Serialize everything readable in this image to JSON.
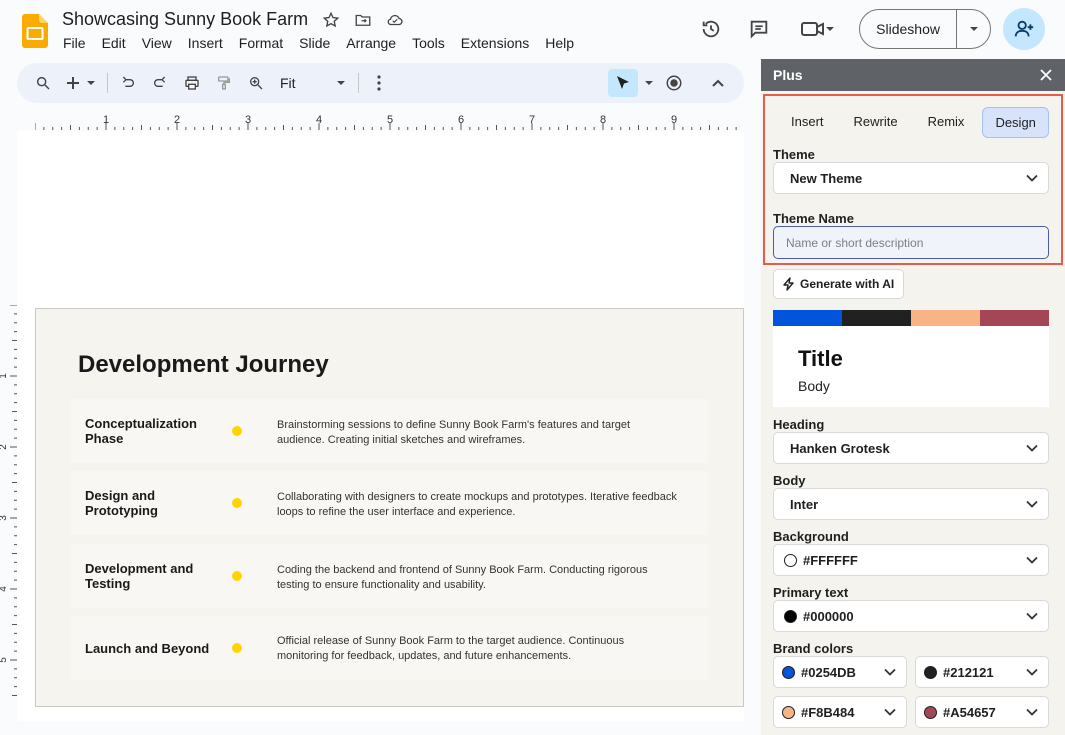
{
  "document": {
    "title": "Showcasing Sunny Book Farm"
  },
  "menu": [
    "File",
    "Edit",
    "View",
    "Insert",
    "Format",
    "Slide",
    "Arrange",
    "Tools",
    "Extensions",
    "Help"
  ],
  "header": {
    "slideshow_label": "Slideshow"
  },
  "toolbar": {
    "zoom_value": "Fit"
  },
  "ruler": {
    "h_numbers": [
      "1",
      "2",
      "3",
      "4",
      "5",
      "6",
      "7",
      "8",
      "9"
    ],
    "v_numbers": [
      "1",
      "2",
      "3",
      "4",
      "5"
    ]
  },
  "slide": {
    "title": "Development Journey",
    "phases": [
      {
        "name": "Conceptualization Phase",
        "description": "Brainstorming sessions to define Sunny Book Farm's features and target audience. Creating initial sketches and wireframes."
      },
      {
        "name": "Design and Prototyping",
        "description": "Collaborating with designers to create mockups and prototypes. Iterative feedback loops to refine the user interface and experience."
      },
      {
        "name": "Development and Testing",
        "description": "Coding the backend and frontend of Sunny Book Farm. Conducting rigorous testing to ensure functionality and usability."
      },
      {
        "name": "Launch and Beyond",
        "description": "Official release of Sunny Book Farm to the target audience. Continuous monitoring for feedback, updates, and future enhancements."
      }
    ],
    "dot_color": "#FFD400"
  },
  "panel": {
    "title": "Plus",
    "tabs": [
      "Insert",
      "Rewrite",
      "Remix",
      "Design"
    ],
    "active_tab": "Design",
    "theme_label": "Theme",
    "theme_value": "New Theme",
    "theme_name_label": "Theme Name",
    "theme_name_placeholder": "Name or short description",
    "theme_name_value": "",
    "generate_label": "Generate with AI",
    "palette": [
      "#0254DB",
      "#212121",
      "#F8B484",
      "#A54657"
    ],
    "preview_title": "Title",
    "preview_body": "Body",
    "heading_label": "Heading",
    "heading_value": "Hanken Grotesk",
    "body_label": "Body",
    "body_value": "Inter",
    "background_label": "Background",
    "background_value": "#FFFFFF",
    "primary_text_label": "Primary text",
    "primary_text_value": "#000000",
    "brand_colors_label": "Brand colors",
    "brand_colors": [
      "#0254DB",
      "#212121",
      "#F8B484",
      "#A54657"
    ]
  },
  "colors": {
    "accent_blue": "#0B57D0",
    "highlight_red": "#E35D4F",
    "panel_header": "#5F6368"
  }
}
